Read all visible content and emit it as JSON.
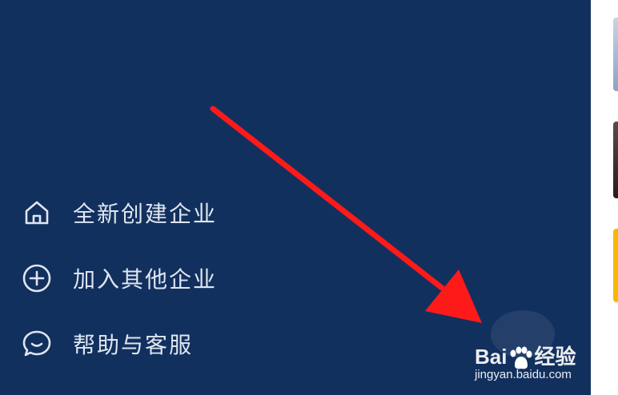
{
  "menu": {
    "items": [
      {
        "label": "全新创建企业",
        "icon": "home-icon"
      },
      {
        "label": "加入其他企业",
        "icon": "plus-circle-icon"
      },
      {
        "label": "帮助与客服",
        "icon": "chat-bubble-icon"
      }
    ]
  },
  "watermark": {
    "brand_left": "Bai",
    "brand_right": "经验",
    "url": "jingyan.baidu.com"
  },
  "colors": {
    "drawer_background": "#12305e",
    "menu_text": "#dfe6f1",
    "annotation_arrow": "#ff1a1a"
  }
}
